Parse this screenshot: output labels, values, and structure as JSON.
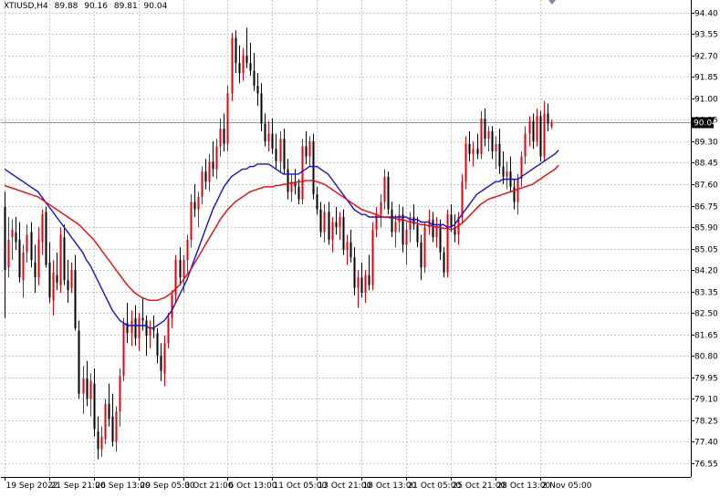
{
  "symbol_label": "XTIUSD,H4",
  "ohlc": {
    "open": "89.88",
    "high": "90.16",
    "low": "89.81",
    "close": "90.04"
  },
  "current_price_label": "90.04",
  "colors": {
    "bull": "#e8000b",
    "bear": "#000000",
    "ma_fast": "#1010e0",
    "ma_slow": "#ff0000",
    "grid": "#c8c8c8",
    "axis": "#000000",
    "price_line": "#8a98a8",
    "price_box": "#000000"
  },
  "chart_data": {
    "type": "candlestick",
    "title": "XTIUSD,H4",
    "ylim": [
      76.0,
      94.9
    ],
    "y_ticks": [
      "94.40",
      "93.55",
      "92.70",
      "91.85",
      "91.00",
      "90.15",
      "89.30",
      "88.45",
      "87.60",
      "86.75",
      "85.90",
      "85.05",
      "84.20",
      "83.35",
      "82.50",
      "81.65",
      "80.80",
      "79.95",
      "79.10",
      "78.25",
      "77.40",
      "76.55"
    ],
    "x_ticks": [
      "19 Sep 2022",
      "21 Sep 21:00",
      "26 Sep 13:00",
      "29 Sep 05:00",
      "3 Oct 21:00",
      "6 Oct 13:00",
      "11 Oct 05:00",
      "13 Oct 21:00",
      "18 Oct 13:00",
      "21 Oct 05:00",
      "25 Oct 21:00",
      "28 Oct 13:00",
      "2 Nov 05:00"
    ],
    "x_tick_index": [
      0,
      12,
      24,
      36,
      48,
      60,
      72,
      84,
      96,
      108,
      120,
      132,
      144
    ],
    "candles": [
      [
        86.7,
        87.3,
        82.3,
        84.2
      ],
      [
        84.3,
        86.3,
        83.9,
        85.4
      ],
      [
        85.5,
        86.2,
        84.6,
        85.8
      ],
      [
        85.7,
        86.3,
        85.0,
        85.3
      ],
      [
        85.4,
        86.1,
        83.7,
        83.9
      ],
      [
        83.8,
        85.2,
        83.1,
        84.9
      ],
      [
        84.9,
        86.0,
        84.5,
        85.6
      ],
      [
        85.7,
        86.1,
        84.3,
        84.6
      ],
      [
        84.5,
        85.2,
        83.3,
        83.9
      ],
      [
        83.9,
        85.9,
        83.6,
        85.4
      ],
      [
        85.3,
        86.6,
        84.8,
        86.4
      ],
      [
        86.5,
        86.7,
        84.3,
        84.4
      ],
      [
        84.5,
        85.3,
        82.9,
        83.1
      ],
      [
        83.0,
        84.6,
        82.4,
        84.1
      ],
      [
        84.0,
        84.9,
        83.4,
        83.7
      ],
      [
        83.6,
        85.9,
        83.3,
        85.6
      ],
      [
        85.5,
        86.0,
        83.6,
        83.8
      ],
      [
        83.8,
        84.6,
        82.9,
        83.4
      ],
      [
        83.5,
        84.5,
        83.3,
        84.2
      ],
      [
        84.2,
        84.8,
        81.8,
        81.9
      ],
      [
        81.8,
        82.2,
        79.1,
        79.3
      ],
      [
        79.3,
        80.4,
        78.5,
        79.9
      ],
      [
        79.9,
        80.6,
        78.8,
        79.1
      ],
      [
        79.1,
        80.1,
        78.4,
        79.8
      ],
      [
        79.7,
        80.3,
        77.6,
        77.9
      ],
      [
        77.8,
        78.4,
        76.7,
        77.1
      ],
      [
        77.1,
        78.0,
        76.8,
        77.6
      ],
      [
        77.5,
        79.1,
        77.3,
        78.9
      ],
      [
        78.9,
        79.7,
        78.0,
        78.3
      ],
      [
        78.4,
        79.3,
        77.2,
        77.4
      ],
      [
        77.4,
        78.8,
        77.0,
        78.6
      ],
      [
        78.6,
        80.3,
        78.0,
        80.0
      ],
      [
        80.0,
        82.3,
        79.8,
        82.1
      ],
      [
        82.1,
        82.9,
        81.3,
        81.7
      ],
      [
        81.7,
        82.6,
        81.2,
        82.2
      ],
      [
        82.3,
        82.8,
        81.2,
        81.5
      ],
      [
        81.5,
        82.5,
        81.0,
        82.3
      ],
      [
        82.3,
        83.1,
        81.8,
        82.2
      ],
      [
        82.2,
        82.4,
        80.8,
        81.6
      ],
      [
        81.6,
        82.2,
        81.1,
        81.9
      ],
      [
        81.9,
        82.4,
        81.5,
        81.8
      ],
      [
        81.7,
        81.9,
        80.5,
        80.8
      ],
      [
        80.8,
        81.3,
        79.8,
        80.2
      ],
      [
        80.1,
        81.6,
        79.6,
        81.3
      ],
      [
        81.3,
        82.5,
        81.1,
        82.3
      ],
      [
        82.3,
        83.4,
        81.9,
        83.2
      ],
      [
        83.2,
        84.8,
        82.9,
        84.6
      ],
      [
        84.6,
        85.1,
        83.6,
        83.9
      ],
      [
        83.9,
        84.8,
        83.3,
        84.6
      ],
      [
        84.6,
        85.6,
        84.1,
        85.4
      ],
      [
        85.4,
        87.2,
        85.1,
        86.9
      ],
      [
        86.9,
        87.6,
        86.3,
        86.6
      ],
      [
        86.6,
        87.3,
        85.9,
        87.1
      ],
      [
        87.1,
        88.3,
        86.8,
        88.1
      ],
      [
        88.1,
        88.6,
        87.4,
        87.7
      ],
      [
        87.7,
        88.8,
        87.3,
        88.5
      ],
      [
        88.5,
        89.3,
        87.9,
        88.2
      ],
      [
        88.2,
        89.4,
        87.8,
        89.1
      ],
      [
        89.1,
        90.2,
        88.7,
        89.8
      ],
      [
        89.8,
        90.4,
        88.9,
        89.2
      ],
      [
        89.2,
        91.5,
        88.9,
        91.2
      ],
      [
        91.2,
        93.6,
        90.9,
        93.4
      ],
      [
        93.4,
        93.7,
        92.0,
        92.4
      ],
      [
        92.4,
        93.1,
        91.6,
        92.0
      ],
      [
        92.0,
        93.0,
        91.7,
        92.7
      ],
      [
        92.7,
        93.8,
        92.2,
        92.4
      ],
      [
        92.4,
        93.2,
        91.9,
        92.1
      ],
      [
        92.1,
        92.8,
        91.3,
        91.5
      ],
      [
        91.5,
        92.0,
        90.7,
        91.2
      ],
      [
        91.2,
        91.6,
        89.7,
        90.0
      ],
      [
        90.0,
        90.4,
        89.1,
        89.3
      ],
      [
        89.3,
        90.1,
        88.9,
        89.6
      ],
      [
        89.6,
        90.2,
        88.8,
        89.0
      ],
      [
        89.0,
        89.6,
        88.2,
        88.5
      ],
      [
        88.5,
        89.7,
        88.1,
        89.4
      ],
      [
        89.4,
        89.8,
        88.0,
        88.2
      ],
      [
        88.2,
        88.6,
        87.0,
        87.3
      ],
      [
        87.3,
        88.0,
        86.9,
        87.7
      ],
      [
        87.7,
        88.2,
        87.2,
        87.5
      ],
      [
        87.5,
        87.8,
        86.8,
        87.0
      ],
      [
        87.0,
        89.4,
        86.8,
        89.1
      ],
      [
        89.1,
        89.7,
        88.4,
        88.7
      ],
      [
        88.7,
        89.5,
        88.3,
        89.3
      ],
      [
        89.3,
        89.6,
        87.0,
        87.2
      ],
      [
        87.2,
        87.5,
        86.4,
        86.6
      ],
      [
        86.6,
        86.9,
        85.5,
        85.7
      ],
      [
        85.7,
        86.8,
        85.3,
        86.5
      ],
      [
        86.5,
        86.9,
        85.2,
        85.4
      ],
      [
        85.4,
        86.3,
        84.9,
        86.1
      ],
      [
        86.1,
        86.7,
        85.6,
        85.9
      ],
      [
        85.9,
        86.5,
        85.4,
        86.3
      ],
      [
        86.3,
        86.6,
        84.8,
        85.0
      ],
      [
        85.0,
        85.6,
        84.4,
        85.3
      ],
      [
        85.3,
        85.8,
        84.5,
        84.7
      ],
      [
        84.7,
        85.1,
        83.2,
        83.5
      ],
      [
        83.5,
        84.2,
        82.7,
        83.9
      ],
      [
        83.9,
        84.5,
        83.1,
        83.3
      ],
      [
        83.3,
        84.2,
        82.9,
        84.0
      ],
      [
        84.0,
        84.8,
        83.4,
        83.6
      ],
      [
        83.6,
        86.1,
        83.4,
        85.8
      ],
      [
        85.8,
        86.7,
        85.5,
        86.4
      ],
      [
        86.4,
        87.2,
        85.9,
        86.9
      ],
      [
        86.9,
        88.2,
        86.6,
        87.9
      ],
      [
        87.9,
        88.1,
        86.4,
        86.6
      ],
      [
        86.6,
        86.9,
        85.5,
        85.7
      ],
      [
        85.7,
        86.4,
        85.1,
        86.1
      ],
      [
        86.1,
        86.8,
        85.7,
        86.4
      ],
      [
        86.4,
        86.7,
        84.9,
        85.2
      ],
      [
        85.2,
        86.1,
        84.4,
        85.8
      ],
      [
        85.8,
        86.5,
        85.3,
        86.3
      ],
      [
        86.3,
        86.8,
        85.8,
        86.0
      ],
      [
        86.0,
        86.3,
        85.1,
        85.3
      ],
      [
        85.3,
        85.6,
        83.8,
        84.3
      ],
      [
        84.3,
        86.1,
        84.1,
        85.9
      ],
      [
        85.9,
        86.6,
        85.6,
        86.2
      ],
      [
        86.2,
        86.5,
        85.3,
        85.5
      ],
      [
        85.5,
        86.3,
        85.1,
        86.0
      ],
      [
        86.0,
        86.2,
        84.6,
        84.9
      ],
      [
        84.9,
        85.1,
        83.9,
        84.1
      ],
      [
        84.1,
        86.6,
        83.9,
        86.4
      ],
      [
        86.4,
        86.8,
        85.7,
        85.9
      ],
      [
        85.9,
        86.4,
        85.3,
        85.6
      ],
      [
        85.6,
        86.5,
        85.2,
        86.3
      ],
      [
        86.3,
        88.0,
        86.1,
        87.7
      ],
      [
        87.7,
        89.5,
        87.4,
        89.2
      ],
      [
        89.2,
        89.7,
        88.5,
        88.8
      ],
      [
        88.8,
        89.3,
        88.3,
        89.0
      ],
      [
        89.0,
        89.6,
        88.6,
        88.8
      ],
      [
        88.8,
        90.5,
        88.6,
        90.2
      ],
      [
        90.2,
        90.6,
        89.1,
        89.4
      ],
      [
        89.4,
        89.9,
        88.9,
        89.7
      ],
      [
        89.7,
        89.9,
        88.6,
        88.9
      ],
      [
        88.9,
        89.5,
        88.2,
        89.2
      ],
      [
        89.2,
        89.8,
        88.0,
        88.3
      ],
      [
        88.3,
        88.9,
        87.6,
        87.9
      ],
      [
        87.9,
        88.5,
        87.4,
        88.1
      ],
      [
        88.1,
        88.7,
        87.3,
        87.5
      ],
      [
        87.5,
        87.8,
        86.6,
        86.9
      ],
      [
        86.9,
        88.0,
        86.4,
        87.8
      ],
      [
        87.8,
        88.9,
        87.5,
        88.7
      ],
      [
        88.7,
        89.9,
        88.4,
        89.6
      ],
      [
        89.6,
        90.3,
        89.1,
        90.1
      ],
      [
        90.1,
        90.4,
        89.0,
        89.3
      ],
      [
        89.3,
        90.6,
        89.1,
        90.3
      ],
      [
        90.3,
        90.5,
        88.5,
        88.7
      ],
      [
        88.7,
        90.9,
        88.5,
        90.4
      ],
      [
        90.4,
        90.8,
        89.7,
        90.0
      ],
      [
        89.88,
        90.16,
        89.81,
        90.04
      ]
    ],
    "series": [
      {
        "name": "MA fast",
        "values": [
          88.2,
          88.1,
          88.0,
          87.9,
          87.8,
          87.7,
          87.6,
          87.5,
          87.4,
          87.3,
          87.1,
          86.9,
          86.7,
          86.5,
          86.3,
          86.1,
          85.9,
          85.7,
          85.5,
          85.3,
          85.1,
          84.9,
          84.6,
          84.4,
          84.1,
          83.8,
          83.5,
          83.2,
          82.9,
          82.6,
          82.4,
          82.2,
          82.1,
          82.0,
          82.0,
          82.0,
          82.0,
          82.0,
          82.0,
          81.9,
          81.9,
          82.0,
          82.1,
          82.2,
          82.4,
          82.6,
          82.9,
          83.2,
          83.5,
          83.8,
          84.2,
          84.6,
          85.0,
          85.4,
          85.8,
          86.2,
          86.6,
          86.9,
          87.2,
          87.5,
          87.7,
          87.9,
          88.0,
          88.1,
          88.2,
          88.2,
          88.3,
          88.3,
          88.4,
          88.4,
          88.4,
          88.4,
          88.3,
          88.2,
          88.1,
          88.0,
          88.0,
          88.0,
          88.0,
          88.0,
          88.1,
          88.2,
          88.3,
          88.3,
          88.3,
          88.2,
          88.1,
          88.0,
          87.8,
          87.6,
          87.4,
          87.2,
          87.0,
          86.8,
          86.6,
          86.5,
          86.4,
          86.4,
          86.3,
          86.3,
          86.3,
          86.3,
          86.3,
          86.3,
          86.3,
          86.3,
          86.3,
          86.3,
          86.3,
          86.2,
          86.2,
          86.2,
          86.1,
          86.1,
          86.1,
          86.0,
          86.0,
          86.0,
          86.0,
          85.9,
          85.9,
          86.0,
          86.2,
          86.4,
          86.6,
          86.8,
          87.0,
          87.2,
          87.3,
          87.4,
          87.5,
          87.6,
          87.7,
          87.7,
          87.8,
          87.8,
          87.8,
          87.8,
          87.8,
          87.9,
          88.0,
          88.1,
          88.2,
          88.3,
          88.4,
          88.5,
          88.6,
          88.7,
          88.8,
          88.95
        ]
      },
      {
        "name": "MA slow",
        "values": [
          87.55,
          87.5,
          87.45,
          87.4,
          87.35,
          87.3,
          87.25,
          87.2,
          87.15,
          87.1,
          87.0,
          86.9,
          86.8,
          86.7,
          86.6,
          86.5,
          86.4,
          86.3,
          86.2,
          86.1,
          86.0,
          85.85,
          85.7,
          85.55,
          85.4,
          85.2,
          85.0,
          84.8,
          84.6,
          84.4,
          84.2,
          84.0,
          83.8,
          83.6,
          83.45,
          83.3,
          83.2,
          83.1,
          83.05,
          83.0,
          83.0,
          83.0,
          83.05,
          83.1,
          83.2,
          83.3,
          83.45,
          83.6,
          83.8,
          84.0,
          84.2,
          84.45,
          84.7,
          84.95,
          85.2,
          85.45,
          85.7,
          85.95,
          86.2,
          86.4,
          86.6,
          86.75,
          86.9,
          87.0,
          87.1,
          87.2,
          87.3,
          87.35,
          87.4,
          87.45,
          87.5,
          87.5,
          87.5,
          87.55,
          87.55,
          87.6,
          87.6,
          87.65,
          87.65,
          87.7,
          87.7,
          87.75,
          87.75,
          87.75,
          87.7,
          87.65,
          87.6,
          87.5,
          87.4,
          87.3,
          87.2,
          87.1,
          87.0,
          86.9,
          86.8,
          86.7,
          86.6,
          86.55,
          86.5,
          86.45,
          86.4,
          86.35,
          86.3,
          86.3,
          86.25,
          86.25,
          86.2,
          86.2,
          86.15,
          86.1,
          86.1,
          86.05,
          86.0,
          86.0,
          85.95,
          85.95,
          85.9,
          85.9,
          85.85,
          85.85,
          85.8,
          85.85,
          85.95,
          86.05,
          86.2,
          86.35,
          86.5,
          86.65,
          86.8,
          86.9,
          87.0,
          87.05,
          87.1,
          87.15,
          87.2,
          87.25,
          87.3,
          87.35,
          87.4,
          87.45,
          87.5,
          87.55,
          87.6,
          87.7,
          87.8,
          87.9,
          88.0,
          88.1,
          88.2,
          88.35
        ]
      }
    ],
    "grid": true,
    "legend": "none"
  }
}
